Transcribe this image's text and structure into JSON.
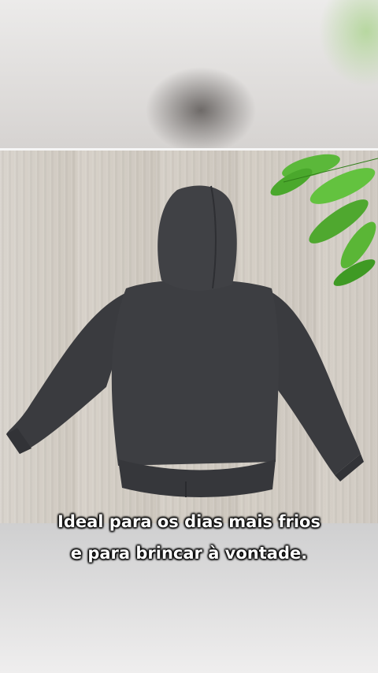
{
  "caption": {
    "line1": "Ideal para os dias mais frios",
    "line2": "e para brincar à vontade."
  },
  "colors": {
    "hoodie": "#3c3d41",
    "leaf": "#4fa82f",
    "caption_text": "#ffffff"
  },
  "image": {
    "subject": "hoodie-back-photo",
    "decoration": "green-leaves"
  }
}
